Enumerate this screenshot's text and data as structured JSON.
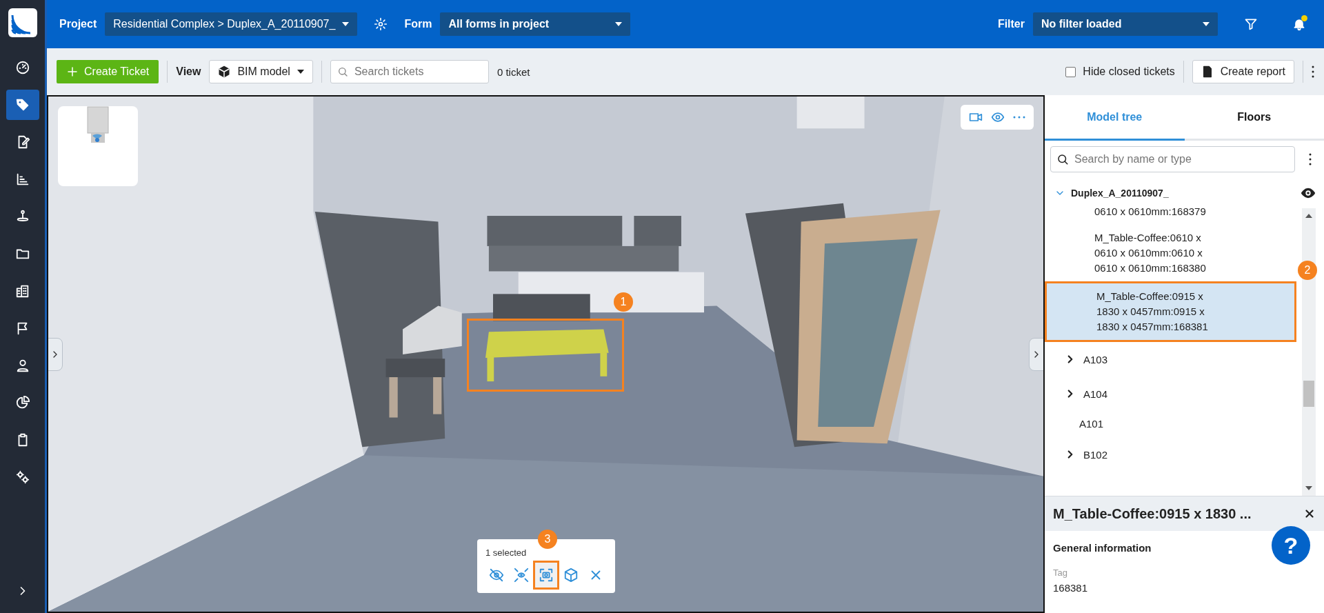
{
  "top_bar": {
    "project_label": "Project",
    "project": "Residential Complex > Duplex_A_20110907_",
    "form_label": "Form",
    "form": "All forms in project",
    "filter_label": "Filter",
    "filter": "No filter loaded",
    "notification": true
  },
  "nav": [
    {
      "selected": false
    },
    {
      "selected": true
    },
    {
      "selected": false
    },
    {
      "selected": false
    },
    {
      "selected": false
    },
    {
      "selected": false
    },
    {
      "selected": false
    },
    {
      "selected": false
    },
    {
      "selected": false
    },
    {
      "selected": false
    },
    {
      "selected": false
    },
    {
      "selected": false
    }
  ],
  "toolbar": {
    "create_button": "Create Ticket",
    "view_label": "View",
    "view": "BIM model",
    "search": {
      "placeholder": "Search tickets"
    },
    "ticket_count": "0 ticket",
    "hide_closed": {
      "label": "Hide closed tickets",
      "checked": false
    },
    "report_button": "Create report"
  },
  "viewer": {
    "annotation": "1",
    "selection": {
      "count": "1 selected",
      "annotation": "3",
      "actions": [
        {
          "selected": false
        },
        {
          "selected": false
        },
        {
          "selected": true
        },
        {
          "selected": false
        },
        {
          "selected": false
        }
      ]
    }
  },
  "model_panel": {
    "tabs": [
      {
        "label": "Model tree",
        "selected": true
      },
      {
        "label": "Floors",
        "selected": false
      }
    ],
    "search": {
      "placeholder": "Search by name or type"
    },
    "annotation": "2",
    "tree": {
      "label": "Duplex_A_20110907_",
      "expanded": true,
      "selected": false,
      "children": [
        {
          "children": [
            {
              "label": "0610 x 0610mm:168379",
              "kind": "leaf",
              "selected": false
            },
            {
              "label": "M_Table-Coffee:0610 x 0610 x 0610mm:0610 x 0610 x 0610mm:168380",
              "kind": "leaf",
              "selected": false
            },
            {
              "label": "M_Table-Coffee:0915 x 1830 x 0457mm:0915 x 1830 x 0457mm:168381",
              "kind": "leaf",
              "selected": true
            }
          ]
        },
        {
          "label": "A103",
          "kind": "group",
          "expanded": false,
          "selected": false
        },
        {
          "label": "A104",
          "kind": "group",
          "expanded": false,
          "selected": false
        },
        {
          "label": "A101",
          "kind": "leaf",
          "selected": false
        },
        {
          "label": "B102",
          "kind": "group",
          "expanded": false,
          "selected": false
        }
      ]
    }
  },
  "details": {
    "title": "M_Table-Coffee:0915 x 1830 ...",
    "section": "General information",
    "fields": [
      {
        "label": "Tag",
        "value": "168381"
      }
    ]
  },
  "help": "?"
}
